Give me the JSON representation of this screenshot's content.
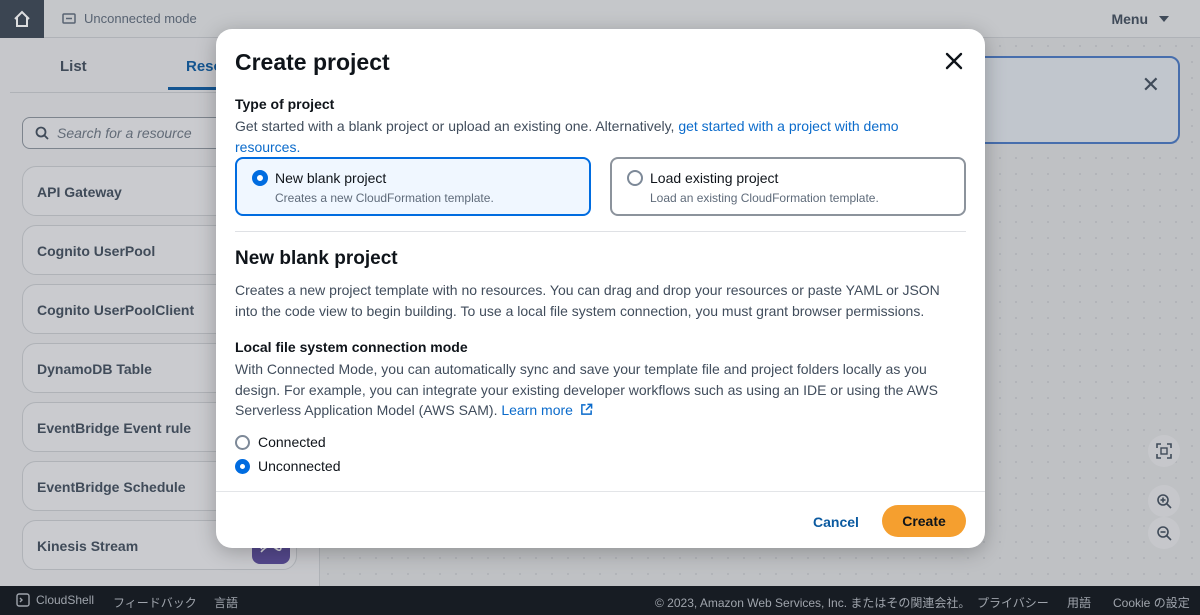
{
  "topbar": {
    "mode_label": "Unconnected mode",
    "menu_label": "Menu"
  },
  "left_panel": {
    "tabs": [
      {
        "label": "List"
      },
      {
        "label": "Reso"
      }
    ],
    "search_placeholder": "Search for a resource",
    "resources": [
      {
        "label": "API Gateway"
      },
      {
        "label": "Cognito UserPool"
      },
      {
        "label": "Cognito UserPoolClient"
      },
      {
        "label": "DynamoDB Table"
      },
      {
        "label": "EventBridge Event rule"
      },
      {
        "label": "EventBridge Schedule"
      },
      {
        "label": "Kinesis Stream"
      }
    ]
  },
  "modal": {
    "title": "Create project",
    "type_label": "Type of project",
    "type_desc_prefix": "Get started with a blank project or upload an existing one. Alternatively, ",
    "type_desc_link": "get started with a project with demo resources.",
    "options": [
      {
        "title": "New blank project",
        "desc": "Creates a new CloudFormation template.",
        "selected": true
      },
      {
        "title": "Load existing project",
        "desc": "Load an existing CloudFormation template.",
        "selected": false
      }
    ],
    "section_title": "New blank project",
    "section_desc": "Creates a new project template with no resources. You can drag and drop your resources or paste YAML or JSON into the code view to begin building. To use a local file system connection, you must grant browser permissions.",
    "conn_label": "Local file system connection mode",
    "conn_desc": "With Connected Mode, you can automatically sync and save your template file and project folders locally as you design. For example, you can integrate your existing developer workflows such as using an IDE or using the AWS Serverless Application Model (AWS SAM).",
    "learn_more": "Learn more",
    "modes": [
      {
        "label": "Connected",
        "selected": false
      },
      {
        "label": "Unconnected",
        "selected": true
      }
    ],
    "cancel_label": "Cancel",
    "create_label": "Create"
  },
  "footer": {
    "cloudshell": "CloudShell",
    "feedback": "フィードバック",
    "language": "言語",
    "copyright": "© 2023, Amazon Web Services, Inc. またはその関連会社。",
    "privacy": "プライバシー",
    "terms": "用語",
    "cookie": "Cookie の設定"
  },
  "colors": {
    "accent": "#006ce0",
    "primary_button": "#f59f2f",
    "link": "#0b6bcb"
  }
}
